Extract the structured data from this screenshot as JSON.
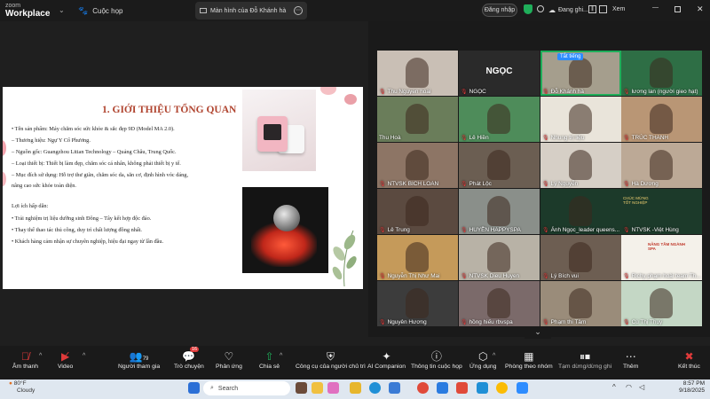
{
  "app": {
    "logo_line1": "zoom",
    "logo_line2": "Workplace",
    "meeting_tab": "Cuộc họp",
    "shared_screen_tab": "Màn hình của Đỗ Khánh hà",
    "login": "Đăng nhập",
    "recording": "Đang ghi...",
    "view": "Xem"
  },
  "slide": {
    "title": "1. GIỚI THIỆU TỔNG QUAN",
    "lines": [
      "•   Tên sản phẩm: Máy chăm sóc sức khỏe & sắc đẹp 9D (Model MA 2.0).",
      "    – Thương hiệu: Ngự Y Cổ Phương.",
      "    – Nguồn gốc: Guangzhou Litian Technology – Quảng Châu, Trung Quốc.",
      "    – Loại thiết bị: Thiết bị làm đẹp, chăm sóc cá nhân, không phải thiết bị y tế.",
      "    – Mục đích sử dụng: Hỗ trợ thư giãn, chăm sóc da, săn cơ, định hình vóc dáng,",
      "nâng cao sức khỏe toàn diện.",
      "Lợi ích hấp dẫn:",
      "• Trải nghiệm trị liệu dưỡng sinh Đông – Tây kết hợp độc đáo.",
      "• Thay thế thao tác thủ công, duy trì chất lượng đồng nhất.",
      "• Khách hàng cảm nhận sự chuyên nghiệp, hiệu đại ngay từ lần đầu."
    ]
  },
  "gallery": {
    "live_transcript_label": "Tắt tiếng",
    "participants": [
      {
        "name": "Thu Nguyen hoai",
        "muted": true
      },
      {
        "name": "NGỌC",
        "muted": true,
        "label_big": "NGỌC"
      },
      {
        "name": "Đỗ Khánh hà",
        "muted": true
      },
      {
        "name": "lương lan (người gieo hạt)",
        "muted": true
      },
      {
        "name": "Thu Hoà",
        "muted": false
      },
      {
        "name": "Lê Hiền",
        "muted": true
      },
      {
        "name": "Nhung trị liệu",
        "muted": true
      },
      {
        "name": "TRÚC THANH",
        "muted": true
      },
      {
        "name": "NTVSK BICH LOAN",
        "muted": true
      },
      {
        "name": "Phát Lộc",
        "muted": true
      },
      {
        "name": "Lý Nguyễn",
        "muted": true
      },
      {
        "name": "Hà Dương",
        "muted": true
      },
      {
        "name": "Lê Trung",
        "muted": true
      },
      {
        "name": "HUYỀN HAPPYSPA",
        "muted": true
      },
      {
        "name": "Ánh Ngọc_leader queens...",
        "muted": true
      },
      {
        "name": "NTVSK -Việt Hùng",
        "muted": true
      },
      {
        "name": "Nguyễn Thị Như Mai",
        "muted": true
      },
      {
        "name": "NTVSK Dieu Huyen",
        "muted": true
      },
      {
        "name": "Lý Bích vui",
        "muted": true
      },
      {
        "name": "Richy phạm hoài team Th...",
        "muted": true
      },
      {
        "name": "Nguyên Hương",
        "muted": true
      },
      {
        "name": "hồng hiếu rbvspa",
        "muted": true
      },
      {
        "name": "Phạm thi Tâm",
        "muted": true
      },
      {
        "name": "Cù Thị Thuý",
        "muted": true
      }
    ],
    "poster_text": "CHÚC MỪNG TỐT NGHIỆP",
    "poster_text2": "NÂNG TẦM NGÀNH SPA"
  },
  "toolbar": {
    "audio": "Âm thanh",
    "video": "Video",
    "participants": "Người tham gia",
    "participants_count": "79",
    "chat": "Trò chuyện",
    "chat_badge": "16",
    "react": "Phản ứng",
    "share": "Chia sẻ",
    "host_tools": "Công cụ của người chủ trì",
    "ai": "AI Companion",
    "meeting_info": "Thông tin cuộc họp",
    "apps": "Ứng dụng",
    "rooms": "Phòng theo nhóm",
    "pause": "Tạm dừng/dừng ghi",
    "more": "Thêm",
    "end": "Kết thúc"
  },
  "taskbar": {
    "temp": "80°F",
    "weather": "Cloudy",
    "search": "Search",
    "time": "8:57 PM",
    "date": "9/18/2025"
  },
  "colors": {
    "accent": "#1fae5a",
    "danger": "#e03a3a",
    "title_red": "#b0442f"
  }
}
